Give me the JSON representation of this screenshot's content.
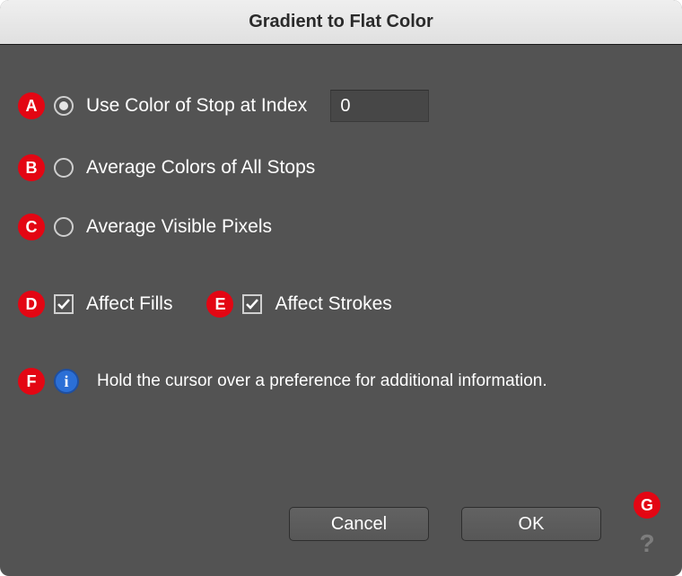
{
  "window": {
    "title": "Gradient to Flat Color"
  },
  "badges": {
    "a": "A",
    "b": "B",
    "c": "C",
    "d": "D",
    "e": "E",
    "f": "F",
    "g": "G"
  },
  "options": {
    "useStop": {
      "label": "Use Color of Stop at Index",
      "selected": true,
      "index_value": "0"
    },
    "avgStops": {
      "label": "Average Colors of All Stops",
      "selected": false
    },
    "avgPixels": {
      "label": "Average Visible Pixels",
      "selected": false
    }
  },
  "checkboxes": {
    "affectFills": {
      "label": "Affect Fills",
      "checked": true
    },
    "affectStrokes": {
      "label": "Affect Strokes",
      "checked": true
    }
  },
  "info": {
    "glyph": "i",
    "hint": "Hold the cursor over a preference for additional information."
  },
  "buttons": {
    "cancel": "Cancel",
    "ok": "OK",
    "help_glyph": "?"
  }
}
